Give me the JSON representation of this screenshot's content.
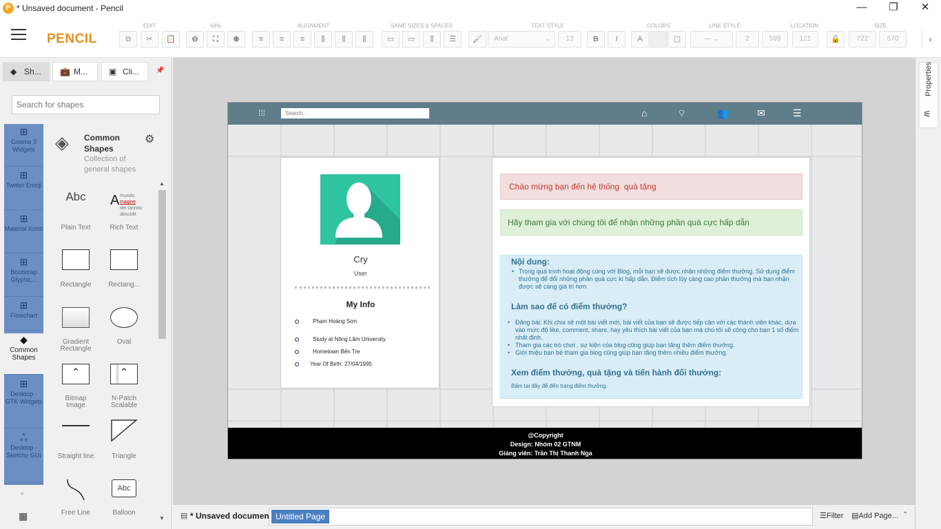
{
  "window": {
    "title": "* Unsaved document - Pencil",
    "minimize": "—",
    "maximize": "❐",
    "close": "✕"
  },
  "toolbar": {
    "brand": "PENCIL",
    "groups": {
      "edit": "EDIT",
      "zoom": "64%",
      "alignment": "ALIGNMENT",
      "same_sizes": "SAME SIZES & SPACES",
      "text_style": "TEXT STYLE",
      "colors": "COLORS",
      "line_style": "LINE STYLE",
      "location": "LOCATION",
      "size": "SIZE"
    },
    "font_name": "Arial",
    "font_size": "13",
    "line_width": "2",
    "loc_x": "599",
    "loc_y": "121",
    "size_w": "722",
    "size_h": "570"
  },
  "left_panel": {
    "tabs": [
      {
        "label": "Sh...",
        "icon": "layers-icon"
      },
      {
        "label": "M...",
        "icon": "briefcase-icon"
      },
      {
        "label": "Cli...",
        "icon": "image-icon"
      }
    ],
    "search_placeholder": "Search for shapes",
    "collections": [
      {
        "label": "Gnome 3 Widgets"
      },
      {
        "label": "Twitter Emoji"
      },
      {
        "label": "Material Icons"
      },
      {
        "label": "Bootstrap Glyphic..."
      },
      {
        "label": "Flowchart"
      },
      {
        "label": "Common Shapes"
      },
      {
        "label": "Desktop - GTK Widgets"
      },
      {
        "label": "Desktop - Sketchy GUI"
      }
    ],
    "active_collection": {
      "title": "Common Shapes",
      "desc": "Collection of general shapes"
    },
    "shapes": [
      "Plain Text",
      "Rich Text",
      "Rectangle",
      "Rectang...",
      "Gradient Rectangle",
      "Oval",
      "Bitmap Image",
      "N-Patch Scalable",
      "Straight line",
      "Triangle",
      "Free Line",
      "Balloon"
    ],
    "plain_text_sample": "Abc",
    "balloon_sample": "Abc"
  },
  "doc": {
    "search_placeholder": "Search..",
    "profile": {
      "name": "Cry",
      "role": "User",
      "my_info": "My Info",
      "items": [
        "Phạm Hoàng Sơn",
        "Study at Nông Lâm University",
        "Hometown Bến Tre",
        "Year Of Birth: 27/04/1995"
      ]
    },
    "alert_welcome": "Chào mừng bạn đến hệ thống",
    "alert_welcome_gift": "quà tặng",
    "alert_join": "Hãy tham gia với chúng tôi để nhận những phần quà cực hấp dẫn",
    "section1_title": "Nội dung:",
    "section1_text": "Trong quá trình hoạt động cùng với Blog, mỗi bạn sẽ được nhận những điểm thưởng. Sử dụng điểm thưởng để đổi những phần quà cực kì hấp dẫn. Điểm tích lũy càng cao phần thưởng mà bạn nhận được sẽ càng giá trị hơn",
    "section2_title": "Làm sao để có điểm thưởng?",
    "section2_items": [
      "Đăng bài: Khi chia sẽ một bài viết mới, bài viết của bạn sẽ được tiếp cận với các thành viên khác, dựa vào mức độ like, comment, share, hay yêu thích bài viết của bạn mà chú tôi sẽ cộng cho bạn 1 số điểm nhất định.",
      "Tham gia các trò chơi , sự kiện của blog cũng giúp bạn tăng thêm điểm thưởng.",
      "Giới thiệu bạn bè tham gia blog cũng giúp bạn tăng thêm nhiều điểm thưởng."
    ],
    "section3_title": "Xem điểm thưởng, quà tặng và tiến hành đổi thưởng:",
    "section3_text": "Bấm tại đây để đến trang điểm thưởng.",
    "footer": {
      "line1": "@Copyright",
      "line2": "Design: Nhóm 02 GTNM",
      "line3": "Giảng viên: Trần Thị Thanh Nga"
    }
  },
  "right_panel": {
    "label": "Properties"
  },
  "bottom": {
    "doc_name": "* Unsaved document",
    "page_tab": "Untitled Page",
    "filter": "Filter",
    "add_page": "Add Page..."
  }
}
